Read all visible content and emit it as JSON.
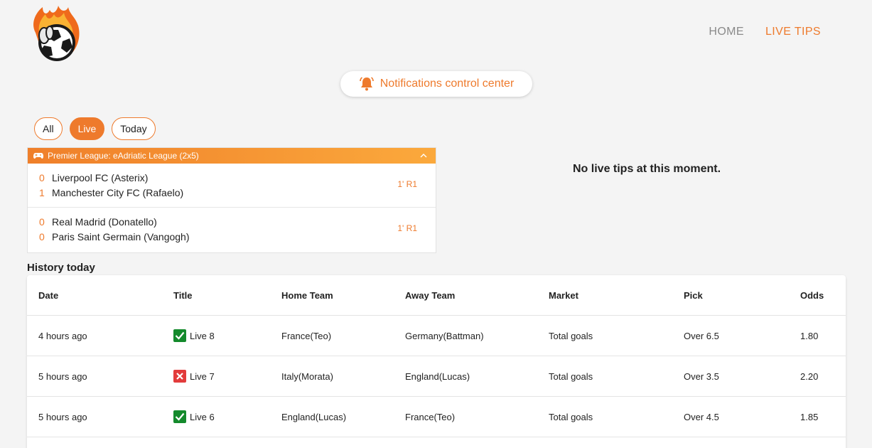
{
  "nav": {
    "home": "HOME",
    "live_tips": "LIVE TIPS"
  },
  "notifications": {
    "label": "Notifications control center",
    "icon": "bell-icon"
  },
  "filters": [
    {
      "label": "All",
      "active": false
    },
    {
      "label": "Live",
      "active": true
    },
    {
      "label": "Today",
      "active": false
    }
  ],
  "league": {
    "title": "Premier League: eAdriatic League (2x5)",
    "icon": "gamepad-icon",
    "matches": [
      {
        "home": {
          "score": "0",
          "name": "Liverpool FC (Asterix)"
        },
        "away": {
          "score": "1",
          "name": "Manchester City FC (Rafaelo)"
        },
        "time": "1' R1"
      },
      {
        "home": {
          "score": "0",
          "name": "Real Madrid (Donatello)"
        },
        "away": {
          "score": "0",
          "name": "Paris Saint Germain (Vangogh)"
        },
        "time": "1' R1"
      }
    ]
  },
  "no_tips": "No live tips at this moment.",
  "history": {
    "title": "History today",
    "columns": {
      "date": "Date",
      "title": "Title",
      "home": "Home Team",
      "away": "Away Team",
      "market": "Market",
      "pick": "Pick",
      "odds": "Odds"
    },
    "rows": [
      {
        "date": "4 hours ago",
        "result": "win",
        "title": "Live 8",
        "home": "France(Teo)",
        "away": "Germany(Battman)",
        "market": "Total goals",
        "pick": "Over 6.5",
        "odds": "1.80"
      },
      {
        "date": "5 hours ago",
        "result": "lose",
        "title": "Live 7",
        "home": "Italy(Morata)",
        "away": "England(Lucas)",
        "market": "Total goals",
        "pick": "Over 3.5",
        "odds": "2.20"
      },
      {
        "date": "5 hours ago",
        "result": "win",
        "title": "Live 6",
        "home": "England(Lucas)",
        "away": "France(Teo)",
        "market": "Total goals",
        "pick": "Over 4.5",
        "odds": "1.85"
      }
    ]
  },
  "colors": {
    "accent": "#ee7a2c",
    "win": "#148a2c",
    "lose": "#e23b3b"
  }
}
